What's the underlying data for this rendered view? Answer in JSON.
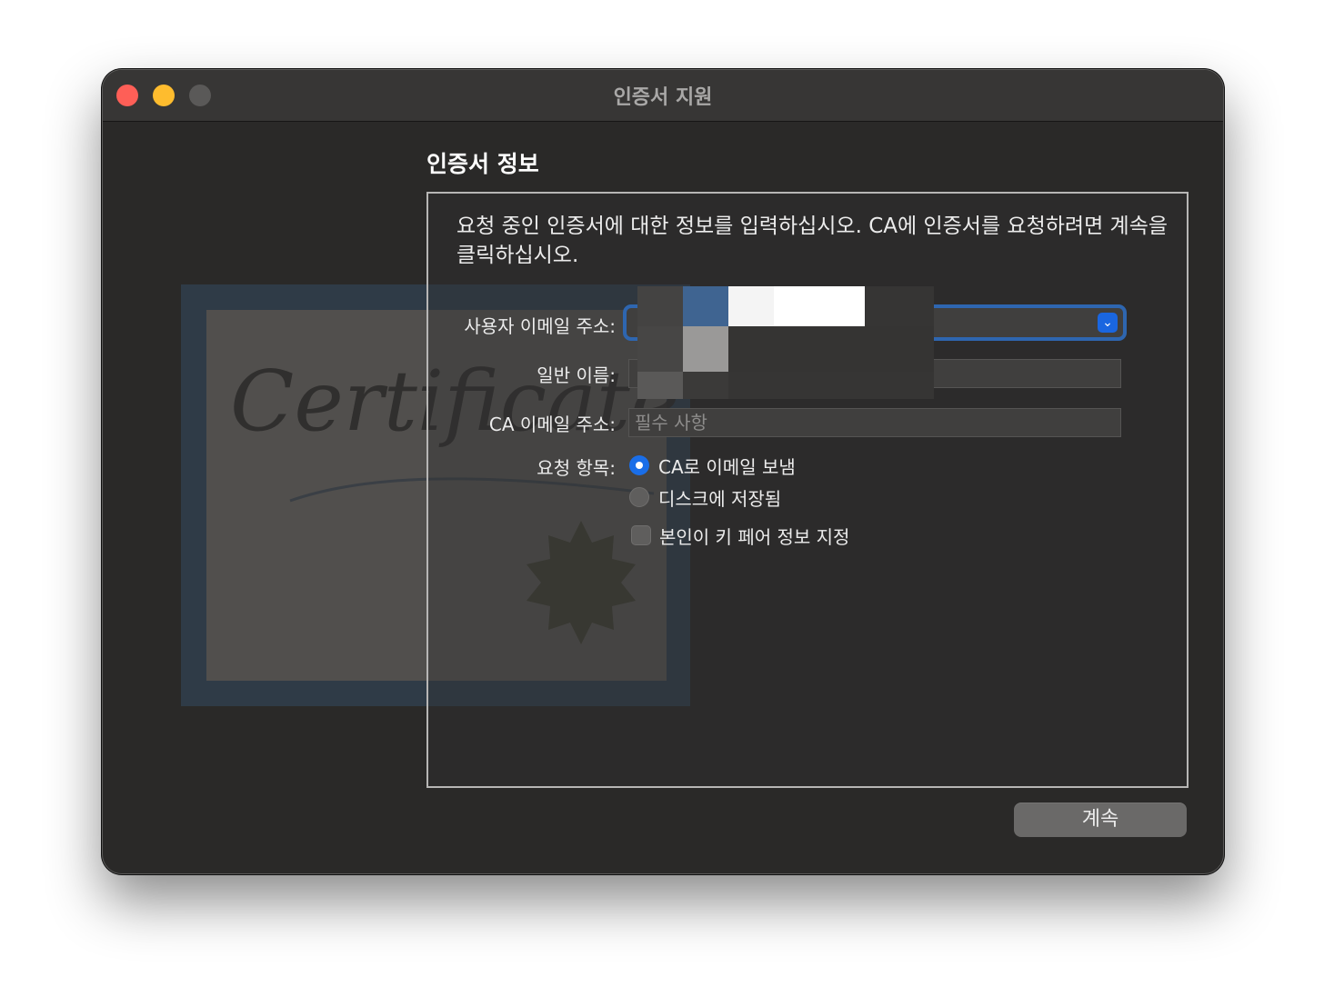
{
  "window": {
    "title": "인증서 지원"
  },
  "form": {
    "heading": "인증서 정보",
    "intro": "요청 중인 인증서에 대한 정보를 입력하십시오. CA에 인증서를 요청하려면 계속을 클릭하십시오.",
    "user_email_label": "사용자 이메일 주소:",
    "common_name_label": "일반 이름:",
    "ca_email_label": "CA 이메일 주소:",
    "ca_email_placeholder": "필수 사항",
    "request_label": "요청 항목:",
    "option_email_ca": "CA로 이메일 보냄",
    "option_save_disk": "디스크에 저장됨",
    "option_key_pair": "본인이 키 페어 정보 지정",
    "selected_option": "CA로 이메일 보냄",
    "key_pair_checked": false
  },
  "illustration": {
    "certificate_script_text": "Certificate"
  },
  "buttons": {
    "continue_label": "계속"
  },
  "colors": {
    "accent": "#1a6ee8",
    "close": "#fe5f57",
    "minimize": "#febc2e"
  }
}
